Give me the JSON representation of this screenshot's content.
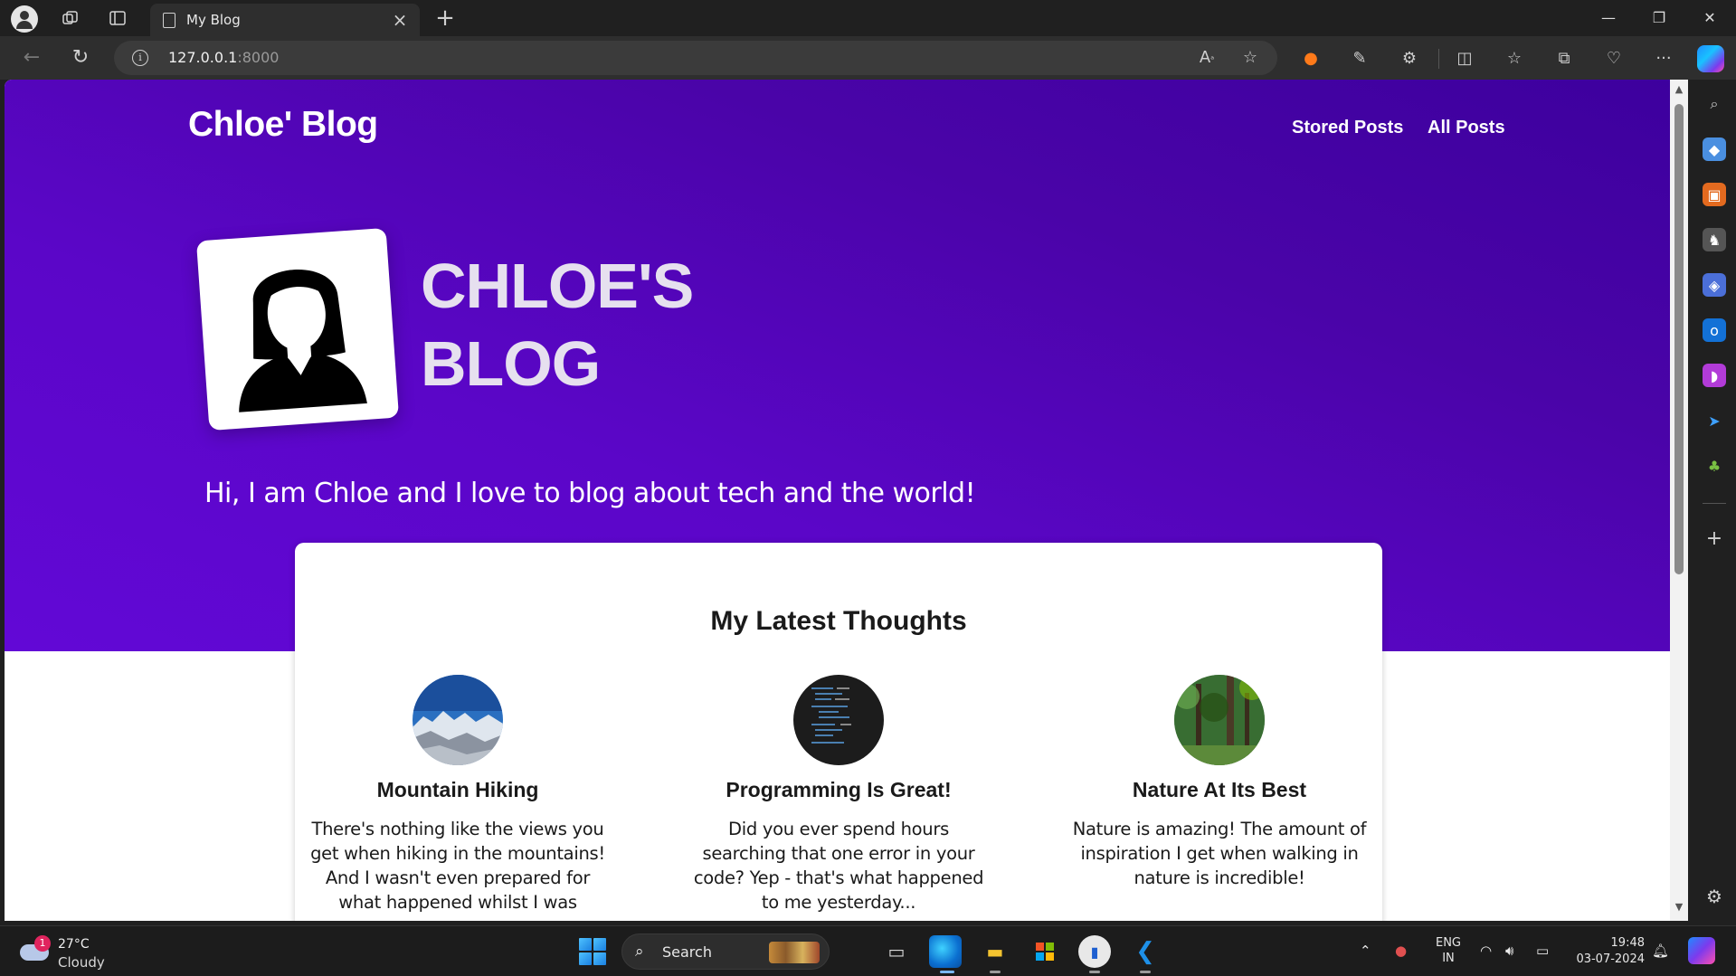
{
  "browser": {
    "tab_title": "My Blog",
    "url_host": "127.0.0.1",
    "url_port": ":8000"
  },
  "page": {
    "site_title": "Chloe' Blog",
    "nav": [
      "Stored Posts",
      "All Posts"
    ],
    "hero_title": "CHLOE'S\nBLOG",
    "hero_subtitle": "Hi, I am Chloe and I love to blog about tech and the world!",
    "section_title": "My Latest Thoughts",
    "posts": [
      {
        "title": "Mountain Hiking",
        "excerpt": "There's nothing like the views you get when hiking in the mountains! And I wasn't even prepared for what happened whilst I was",
        "image": "mountains-photo"
      },
      {
        "title": "Programming Is Great!",
        "excerpt": "Did you ever spend hours searching that one error in your code? Yep - that's what happened to me yesterday...",
        "image": "code-screen-photo"
      },
      {
        "title": "Nature At Its Best",
        "excerpt": "Nature is amazing! The amount of inspiration I get when walking in nature is incredible!",
        "image": "forest-photo"
      }
    ]
  },
  "taskbar": {
    "weather_temp": "27°C",
    "weather_condition": "Cloudy",
    "weather_badge": "1",
    "search_label": "Search",
    "lang_line1": "ENG",
    "lang_line2": "IN",
    "time": "19:48",
    "date": "03-07-2024"
  },
  "colors": {
    "hero_dark": "#3d009e",
    "hero_light": "#6208d6",
    "card_bg": "#ffffff"
  }
}
